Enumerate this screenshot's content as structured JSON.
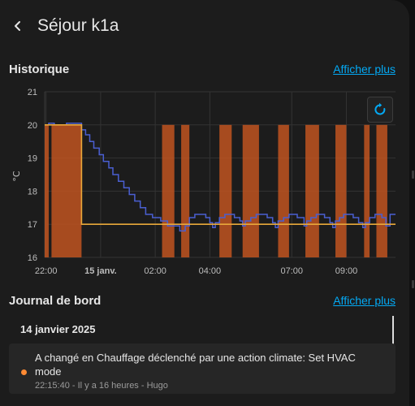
{
  "header": {
    "title": "Séjour k1a"
  },
  "history": {
    "title": "Historique",
    "more_link": "Afficher plus"
  },
  "chart_data": {
    "type": "line",
    "ylabel": "°C",
    "ylim": [
      16,
      21
    ],
    "y_ticks": [
      16,
      17,
      18,
      19,
      20,
      21
    ],
    "x_ticks": [
      {
        "label": "22:00",
        "h": 22.0,
        "bold": false
      },
      {
        "label": "15 janv.",
        "h": 24.0,
        "bold": true
      },
      {
        "label": "02:00",
        "h": 26.0,
        "bold": false
      },
      {
        "label": "04:00",
        "h": 28.0,
        "bold": false
      },
      {
        "label": "07:00",
        "h": 31.0,
        "bold": false
      },
      {
        "label": "09:00",
        "h": 33.0,
        "bold": false
      }
    ],
    "xlim_hours": [
      21.95,
      34.8
    ],
    "grid": true,
    "colors": {
      "current": "#4a5fd1",
      "target": "#e8a83a",
      "heating": "#c05420"
    },
    "series": [
      {
        "key": "current",
        "points": [
          [
            21.95,
            20.0
          ],
          [
            22.1,
            20.0
          ],
          [
            22.1,
            20.05
          ],
          [
            22.3,
            20.05
          ],
          [
            22.3,
            20.0
          ],
          [
            22.75,
            20.0
          ],
          [
            22.75,
            20.05
          ],
          [
            23.3,
            20.05
          ],
          [
            23.3,
            19.85
          ],
          [
            23.45,
            19.85
          ],
          [
            23.45,
            19.7
          ],
          [
            23.6,
            19.7
          ],
          [
            23.6,
            19.5
          ],
          [
            23.75,
            19.5
          ],
          [
            23.75,
            19.3
          ],
          [
            23.95,
            19.3
          ],
          [
            23.95,
            19.1
          ],
          [
            24.1,
            19.1
          ],
          [
            24.1,
            18.9
          ],
          [
            24.3,
            18.9
          ],
          [
            24.3,
            18.7
          ],
          [
            24.45,
            18.7
          ],
          [
            24.45,
            18.5
          ],
          [
            24.65,
            18.5
          ],
          [
            24.65,
            18.3
          ],
          [
            24.85,
            18.3
          ],
          [
            24.85,
            18.1
          ],
          [
            25.05,
            18.1
          ],
          [
            25.05,
            17.9
          ],
          [
            25.25,
            17.9
          ],
          [
            25.25,
            17.7
          ],
          [
            25.45,
            17.7
          ],
          [
            25.45,
            17.5
          ],
          [
            25.65,
            17.5
          ],
          [
            25.65,
            17.3
          ],
          [
            25.9,
            17.3
          ],
          [
            25.9,
            17.2
          ],
          [
            26.2,
            17.2
          ],
          [
            26.2,
            17.1
          ],
          [
            26.45,
            17.1
          ],
          [
            26.45,
            16.95
          ],
          [
            26.9,
            16.95
          ],
          [
            26.9,
            16.8
          ],
          [
            27.1,
            16.8
          ],
          [
            27.1,
            16.95
          ],
          [
            27.25,
            16.95
          ],
          [
            27.25,
            17.2
          ],
          [
            27.45,
            17.2
          ],
          [
            27.45,
            17.3
          ],
          [
            27.85,
            17.3
          ],
          [
            27.85,
            17.2
          ],
          [
            28.0,
            17.2
          ],
          [
            28.0,
            17.05
          ],
          [
            28.1,
            17.05
          ],
          [
            28.1,
            16.9
          ],
          [
            28.2,
            16.9
          ],
          [
            28.2,
            17.05
          ],
          [
            28.35,
            17.05
          ],
          [
            28.35,
            17.2
          ],
          [
            28.55,
            17.2
          ],
          [
            28.55,
            17.3
          ],
          [
            28.9,
            17.3
          ],
          [
            28.9,
            17.2
          ],
          [
            29.1,
            17.2
          ],
          [
            29.1,
            17.1
          ],
          [
            29.2,
            17.1
          ],
          [
            29.2,
            16.95
          ],
          [
            29.3,
            16.95
          ],
          [
            29.3,
            17.1
          ],
          [
            29.5,
            17.1
          ],
          [
            29.5,
            17.2
          ],
          [
            29.7,
            17.2
          ],
          [
            29.7,
            17.3
          ],
          [
            30.1,
            17.3
          ],
          [
            30.1,
            17.2
          ],
          [
            30.3,
            17.2
          ],
          [
            30.3,
            17.05
          ],
          [
            30.4,
            17.05
          ],
          [
            30.4,
            16.9
          ],
          [
            30.5,
            16.9
          ],
          [
            30.5,
            17.1
          ],
          [
            30.7,
            17.1
          ],
          [
            30.7,
            17.2
          ],
          [
            30.9,
            17.2
          ],
          [
            30.9,
            17.3
          ],
          [
            31.2,
            17.3
          ],
          [
            31.2,
            17.2
          ],
          [
            31.45,
            17.2
          ],
          [
            31.45,
            16.95
          ],
          [
            31.55,
            16.95
          ],
          [
            31.55,
            17.1
          ],
          [
            31.7,
            17.1
          ],
          [
            31.7,
            17.2
          ],
          [
            31.9,
            17.2
          ],
          [
            31.9,
            17.3
          ],
          [
            32.2,
            17.3
          ],
          [
            32.2,
            17.2
          ],
          [
            32.4,
            17.2
          ],
          [
            32.4,
            17.05
          ],
          [
            32.5,
            17.05
          ],
          [
            32.5,
            16.9
          ],
          [
            32.6,
            16.9
          ],
          [
            32.6,
            17.1
          ],
          [
            32.75,
            17.1
          ],
          [
            32.75,
            17.2
          ],
          [
            32.9,
            17.2
          ],
          [
            32.9,
            17.3
          ],
          [
            33.25,
            17.3
          ],
          [
            33.25,
            17.2
          ],
          [
            33.45,
            17.2
          ],
          [
            33.45,
            17.05
          ],
          [
            33.6,
            17.05
          ],
          [
            33.6,
            16.9
          ],
          [
            33.7,
            16.9
          ],
          [
            33.7,
            17.05
          ],
          [
            33.85,
            17.05
          ],
          [
            33.85,
            17.2
          ],
          [
            34.05,
            17.2
          ],
          [
            34.05,
            17.3
          ],
          [
            34.3,
            17.3
          ],
          [
            34.3,
            17.2
          ],
          [
            34.45,
            17.2
          ],
          [
            34.45,
            16.95
          ],
          [
            34.6,
            16.95
          ],
          [
            34.6,
            17.3
          ],
          [
            34.8,
            17.3
          ]
        ]
      },
      {
        "key": "target",
        "points": [
          [
            21.95,
            20.0
          ],
          [
            23.3,
            20.0
          ],
          [
            23.3,
            17.0
          ],
          [
            34.8,
            17.0
          ]
        ]
      }
    ],
    "heating_periods": [
      [
        21.95,
        22.1
      ],
      [
        22.2,
        23.3
      ],
      [
        26.25,
        26.7
      ],
      [
        26.95,
        27.25
      ],
      [
        28.35,
        28.8
      ],
      [
        29.2,
        29.8
      ],
      [
        30.5,
        30.9
      ],
      [
        31.5,
        32.0
      ],
      [
        32.6,
        33.0
      ],
      [
        33.65,
        33.85
      ],
      [
        34.1,
        34.5
      ]
    ]
  },
  "journal": {
    "title": "Journal de bord",
    "more_link": "Afficher plus",
    "day_header": "14 janvier 2025",
    "entries": [
      {
        "text": "A changé en Chauffage déclenché par une action climate: Set HVAC mode",
        "meta": "22:15:40 - Il y a 16 heures - Hugo",
        "dot_color": "#ff8a33"
      }
    ]
  }
}
